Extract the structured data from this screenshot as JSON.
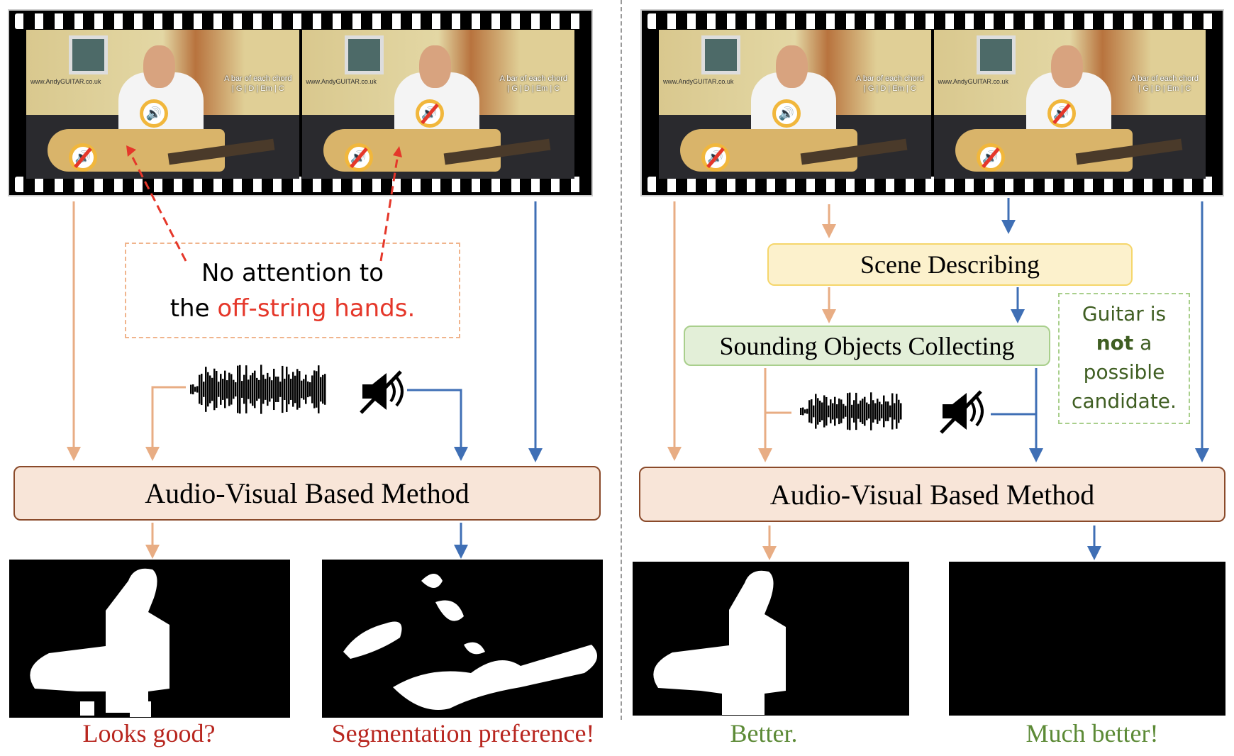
{
  "frame_overlay": {
    "chord_title": "A bar of each chord",
    "chords": "| G | D | Em | C",
    "watermark": "www.AndyGUITAR.co.uk"
  },
  "left": {
    "annotation_line1": "No attention to",
    "annotation_prefix": "the ",
    "annotation_highlight": "off-string hands.",
    "method_label": "Audio-Visual Based Method",
    "caption_1": "Looks good?",
    "caption_2": "Segmentation preference!"
  },
  "right": {
    "scene_label": "Scene Describing",
    "sounding_label": "Sounding Objects Collecting",
    "note_line1": "Guitar is",
    "note_bold": "not",
    "note_line2_rest": " a",
    "note_line3": "possible",
    "note_line4": "candidate.",
    "method_label": "Audio-Visual Based Method",
    "caption_1": "Better.",
    "caption_2": "Much better!"
  },
  "colors": {
    "audio_arrow": "#e8ad84",
    "silent_arrow": "#3f6fb5",
    "attention_arrow": "#e5372a",
    "negative_caption": "#b8261f",
    "positive_caption": "#5c8a36",
    "scene_box": "#fcf1cc",
    "sounding_box": "#e3efd8",
    "method_box": "#f8e5d8"
  },
  "icons": [
    "speaker-icon",
    "muted-speaker-icon",
    "waveform-icon",
    "mute-icon"
  ]
}
